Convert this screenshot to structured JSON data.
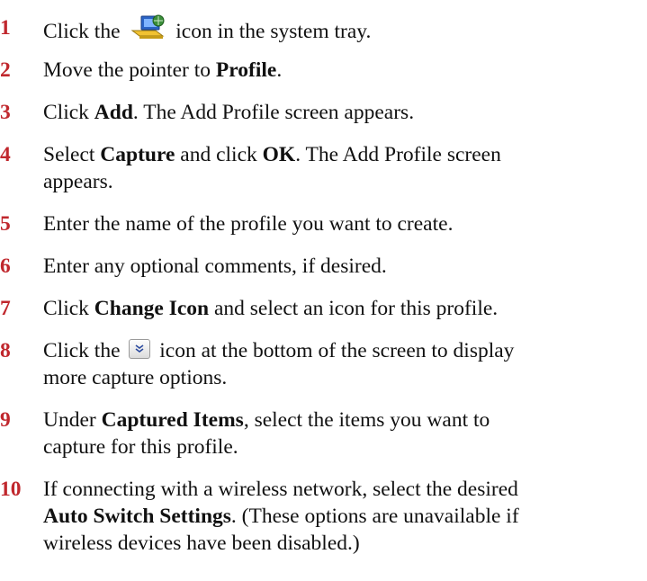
{
  "steps": [
    {
      "num": "1",
      "a": "Click the",
      "icon": "network-computer-icon",
      "b": "icon in the system tray."
    },
    {
      "num": "2",
      "a": "Move the pointer to ",
      "bold": "Profile",
      "b": "."
    },
    {
      "num": "3",
      "a": "Click ",
      "bold": "Add",
      "b": ". The Add Profile screen appears."
    },
    {
      "num": "4",
      "a": "Select ",
      "bold1": "Capture",
      "mid": " and click ",
      "bold2": "OK",
      "b": ". The Add Profile screen",
      "line2": "appears."
    },
    {
      "num": "5",
      "a": "Enter the name of the profile you want to create."
    },
    {
      "num": "6",
      "a": "Enter any optional comments, if desired."
    },
    {
      "num": "7",
      "a": "Click ",
      "bold": "Change Icon",
      "b": " and select an icon for this profile."
    },
    {
      "num": "8",
      "a": "Click the",
      "icon": "expand-chevron-icon",
      "b": "icon at the bottom of the screen to display",
      "line2": "more capture options."
    },
    {
      "num": "9",
      "a": "Under ",
      "bold": "Captured Items",
      "b": ", select the items you want to",
      "line2": "capture for this profile."
    },
    {
      "num": "10",
      "a": "If connecting with a wireless network, select the desired",
      "bold": "Auto Switch Settings",
      "b": ". (These options are unavailable if",
      "line3": "wireless devices have been disabled.)"
    }
  ]
}
